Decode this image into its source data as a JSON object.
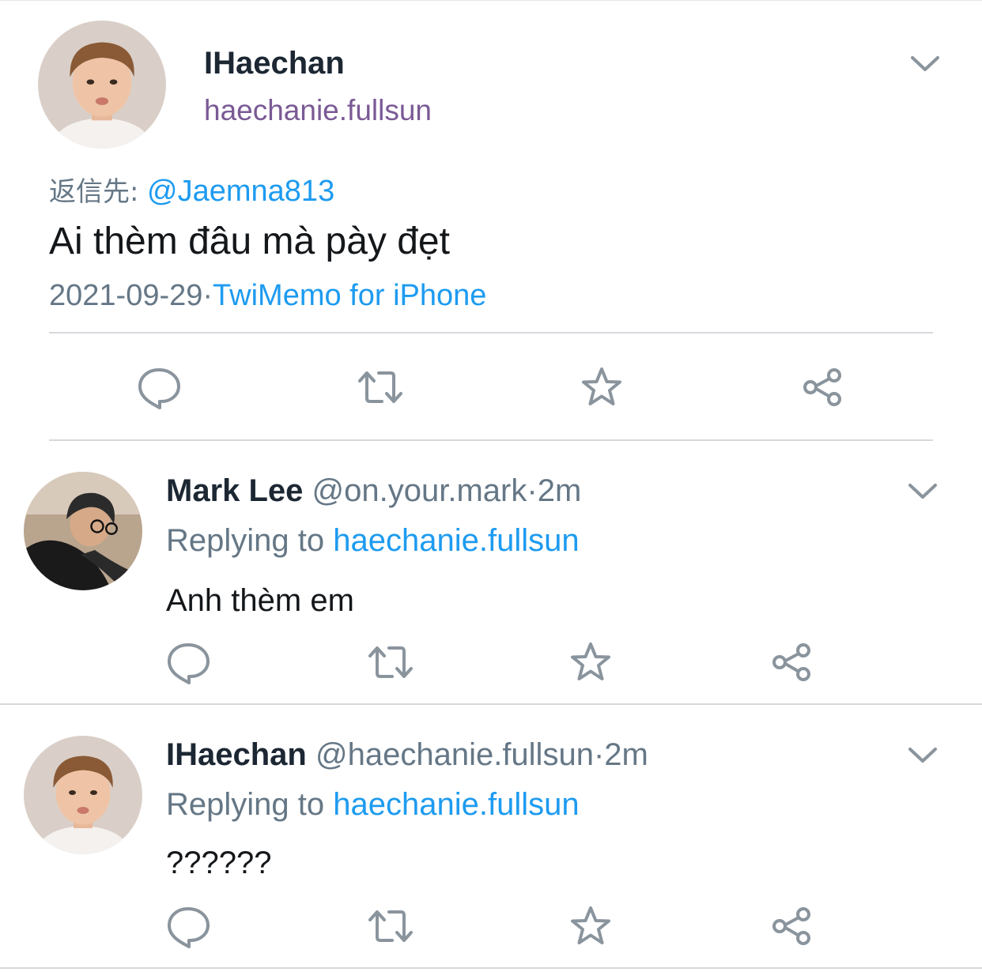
{
  "main_tweet": {
    "display_name": "IHaechan",
    "handle": "haechanie.fullsun",
    "reply_prefix": "返信先:",
    "reply_to": "@Jaemna813",
    "text": "Ai thèm đâu mà pày đẹt",
    "date": "2021-09-29",
    "separator": "·",
    "source": "TwiMemo for iPhone"
  },
  "replies": [
    {
      "display_name": "Mark Lee",
      "handle": "@on.your.mark",
      "time": "·2m",
      "replying_label": "Replying to",
      "replying_to": "haechanie.fullsun",
      "text": "Anh thèm em"
    },
    {
      "display_name": "IHaechan",
      "handle": "@haechanie.fullsun",
      "time": "·2m",
      "replying_label": "Replying to",
      "replying_to": "haechanie.fullsun",
      "text": "??????"
    }
  ],
  "icons": {
    "reply": "speech-bubble-icon",
    "retweet": "retweet-arrows-icon",
    "favorite": "star-icon",
    "share": "share-nodes-icon",
    "menu": "chevron-down-icon"
  },
  "colors": {
    "accent": "#1d9bf0",
    "handle_purple": "#7a5a95",
    "muted": "#657786",
    "icon": "#8a949d",
    "divider": "#d6d9dc"
  }
}
